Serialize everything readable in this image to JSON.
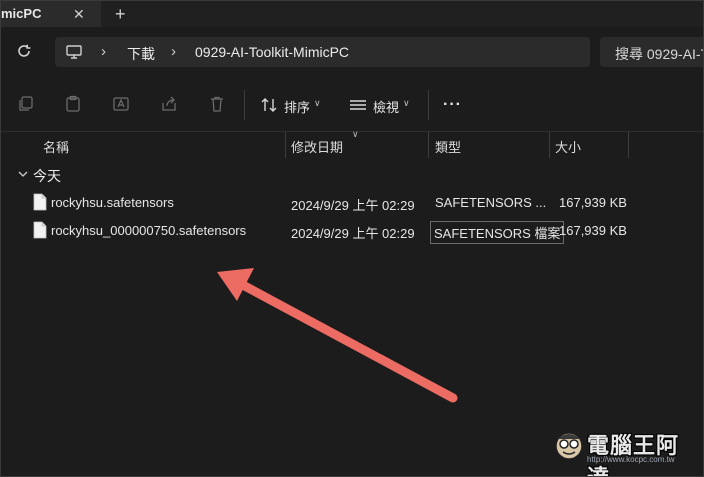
{
  "titlebar": {
    "tab_title": "micPC",
    "close_glyph": "✕",
    "new_tab_glyph": "+"
  },
  "address": {
    "crumbs": [
      "下載",
      "0929-AI-Toolkit-MimicPC"
    ],
    "search_placeholder": "搜尋 0929-AI-T"
  },
  "toolbar": {
    "sort_label": "排序",
    "view_label": "檢視",
    "more_glyph": "···",
    "icons": [
      "copy-icon",
      "paste-icon",
      "rename-icon",
      "share-icon",
      "delete-icon"
    ]
  },
  "columns": {
    "name": "名稱",
    "modified": "修改日期",
    "type": "類型",
    "size": "大小"
  },
  "groups": [
    {
      "label": "今天",
      "files": [
        {
          "name": "rockyhsu.safetensors",
          "modified": "2024/9/29 上午 02:29",
          "type": "SAFETENSORS ...",
          "size": "167,939 KB"
        },
        {
          "name": "rockyhsu_000000750.safetensors",
          "modified": "2024/9/29 上午 02:29",
          "type": "SAFETENSORS 檔案",
          "size": "167,939 KB"
        }
      ]
    }
  ],
  "annotation": {
    "arrow_color": "#ec6b63"
  },
  "watermark": {
    "text": "電腦王阿達",
    "url": "http://www.kocpc.com.tw"
  },
  "colors": {
    "window_bg": "#1c1c1c",
    "bar_bg": "#2b2b2b",
    "text": "#e6e6e6"
  }
}
